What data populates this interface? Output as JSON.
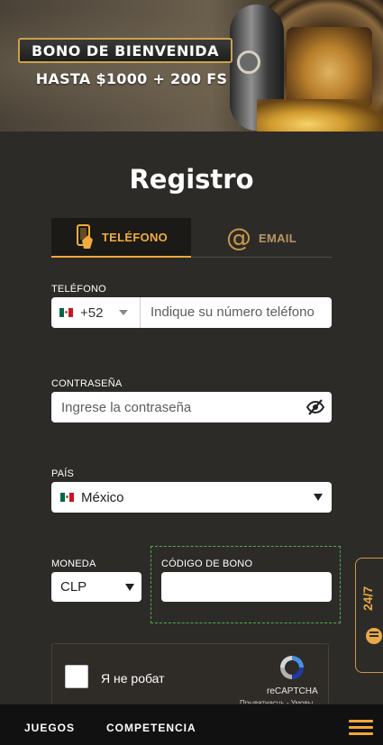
{
  "banner": {
    "title": "BONO DE BIENVENIDA",
    "subtitle": "HASTA $1000 + 200 FS"
  },
  "form": {
    "title": "Registro",
    "tabs": [
      {
        "label": "TELÉFONO",
        "icon": "phone-hand-icon",
        "active": true
      },
      {
        "label": "EMAIL",
        "icon": "at-icon",
        "active": false
      }
    ],
    "phone": {
      "label": "TELÉFONO",
      "country_code": "+52",
      "placeholder": "Indique su número teléfono"
    },
    "password": {
      "label": "CONTRASEÑA",
      "placeholder": "Ingrese la contraseña"
    },
    "country": {
      "label": "PAÍS",
      "value": "México"
    },
    "currency": {
      "label": "MONEDA",
      "value": "CLP"
    },
    "bonus_code": {
      "label": "CÓDIGO DE BONO",
      "value": ""
    },
    "captcha": {
      "label": "Я не робат",
      "brand": "reCAPTCHA",
      "links": "Прыватнасць - Умовы"
    }
  },
  "support": {
    "label": "24/7"
  },
  "bottom_nav": {
    "items": [
      "JUEGOS",
      "COMPETENCIA"
    ]
  },
  "colors": {
    "accent": "#f0a73a",
    "background": "#2d2b27",
    "bottom_bar": "#111111"
  }
}
